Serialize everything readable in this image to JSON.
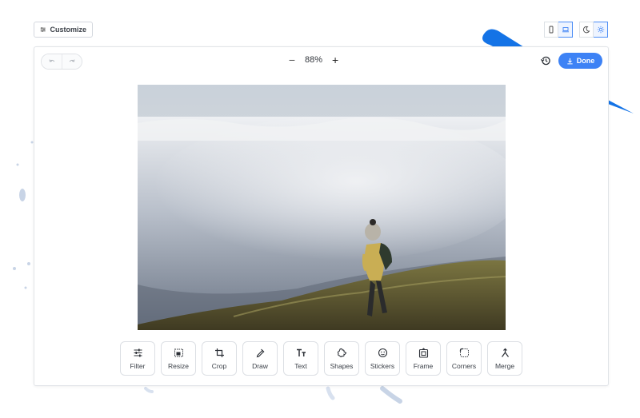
{
  "topbar": {
    "customize_label": "Customize"
  },
  "editor": {
    "zoom_value": "88%",
    "done_label": "Done"
  },
  "tools": [
    {
      "label": "Filter",
      "icon": "sliders-icon"
    },
    {
      "label": "Resize",
      "icon": "resize-icon"
    },
    {
      "label": "Crop",
      "icon": "crop-icon"
    },
    {
      "label": "Draw",
      "icon": "pen-icon"
    },
    {
      "label": "Text",
      "icon": "text-icon"
    },
    {
      "label": "Shapes",
      "icon": "shapes-icon"
    },
    {
      "label": "Stickers",
      "icon": "sticker-icon"
    },
    {
      "label": "Frame",
      "icon": "frame-icon"
    },
    {
      "label": "Corners",
      "icon": "corners-icon"
    },
    {
      "label": "Merge",
      "icon": "merge-icon"
    }
  ],
  "colors": {
    "accent": "#3d82f5",
    "border": "#dcdfe4"
  }
}
